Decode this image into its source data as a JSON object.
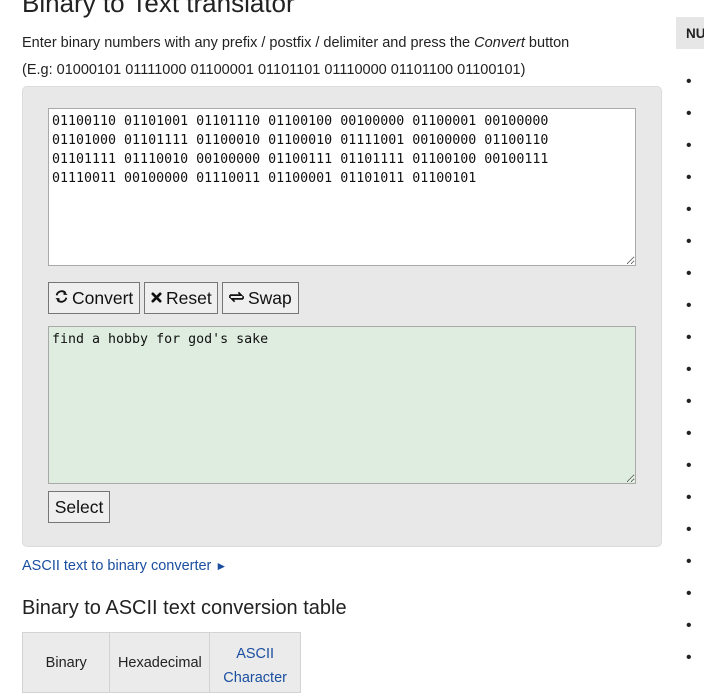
{
  "page": {
    "title": "Binary to Text translator",
    "instruction_prefix": "Enter binary numbers with any prefix / postfix / delimiter and press the ",
    "instruction_emphasis": "Convert",
    "instruction_suffix": " button",
    "example": "(E.g: 01000101 01111000 01100001 01101101 01110000 01101100 01100101)"
  },
  "converter": {
    "input_value": "01100110 01101001 01101110 01100100 00100000 01100001 00100000\n01101000 01101111 01100010 01100010 01111001 00100000 01100110\n01101111 01110010 00100000 01100111 01101111 01100100 00100111\n01110011 00100000 01110011 01100001 01101011 01100101",
    "output_value": "find a hobby for god's sake",
    "convert_label": "Convert",
    "reset_label": "Reset",
    "swap_label": "Swap",
    "select_label": "Select",
    "icons": {
      "convert": "refresh-icon",
      "reset": "close-icon",
      "swap": "swap-icon"
    }
  },
  "links": {
    "ascii_to_binary": "ASCII text to binary converter"
  },
  "table_section": {
    "heading": "Binary to ASCII text conversion table",
    "headers": [
      "Binary",
      "Hexadecimal",
      "ASCII Character"
    ]
  },
  "sidebar": {
    "header": "NU",
    "bullet_count": 19
  },
  "colors": {
    "link": "#1a4fa0",
    "output_bg": "#dfede1",
    "panel_bg": "#e8e8e8"
  }
}
